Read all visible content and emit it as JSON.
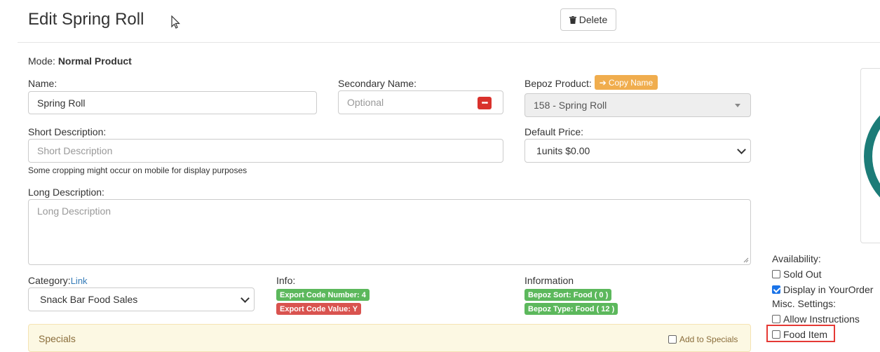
{
  "header": {
    "title": "Edit Spring Roll",
    "delete_label": "Delete"
  },
  "mode": {
    "label": "Mode:",
    "value": "Normal Product"
  },
  "name": {
    "label": "Name:",
    "value": "Spring Roll"
  },
  "secondary_name": {
    "label": "Secondary Name:",
    "placeholder": "Optional"
  },
  "bepoz_product": {
    "label": "Bepoz Product:",
    "copy_label": "Copy Name",
    "value": "158 - Spring Roll"
  },
  "short_description": {
    "label": "Short Description:",
    "placeholder": "Short Description",
    "help": "Some cropping might occur on mobile for display purposes"
  },
  "default_price": {
    "label": "Default Price:",
    "value": "1units $0.00"
  },
  "long_description": {
    "label": "Long Description:",
    "placeholder": "Long Description"
  },
  "category": {
    "label": "Category:",
    "link": "Link",
    "value": "Snack Bar Food Sales"
  },
  "info": {
    "label": "Info:",
    "export_code_number": "Export Code Number: 4",
    "export_code_value": "Export Code Value: Y"
  },
  "information": {
    "label": "Information",
    "bepoz_sort": "Bepoz Sort: Food ( 0 )",
    "bepoz_type": "Bepoz Type: Food ( 12 )"
  },
  "specials": {
    "title": "Specials",
    "add_label": "Add to Specials"
  },
  "availability": {
    "label": "Availability:",
    "sold_out": {
      "label": "Sold Out",
      "checked": false
    },
    "display": {
      "label": "Display in YourOrder",
      "checked": true
    }
  },
  "misc": {
    "label": "Misc. Settings:",
    "allow_instructions": {
      "label": "Allow Instructions",
      "checked": false
    },
    "food_item": {
      "label": "Food Item",
      "checked": false
    }
  },
  "colors": {
    "copy_button": "#f0ad4e",
    "badge_green": "#5cb85c",
    "badge_red": "#d9534f",
    "highlight": "#e53935"
  }
}
